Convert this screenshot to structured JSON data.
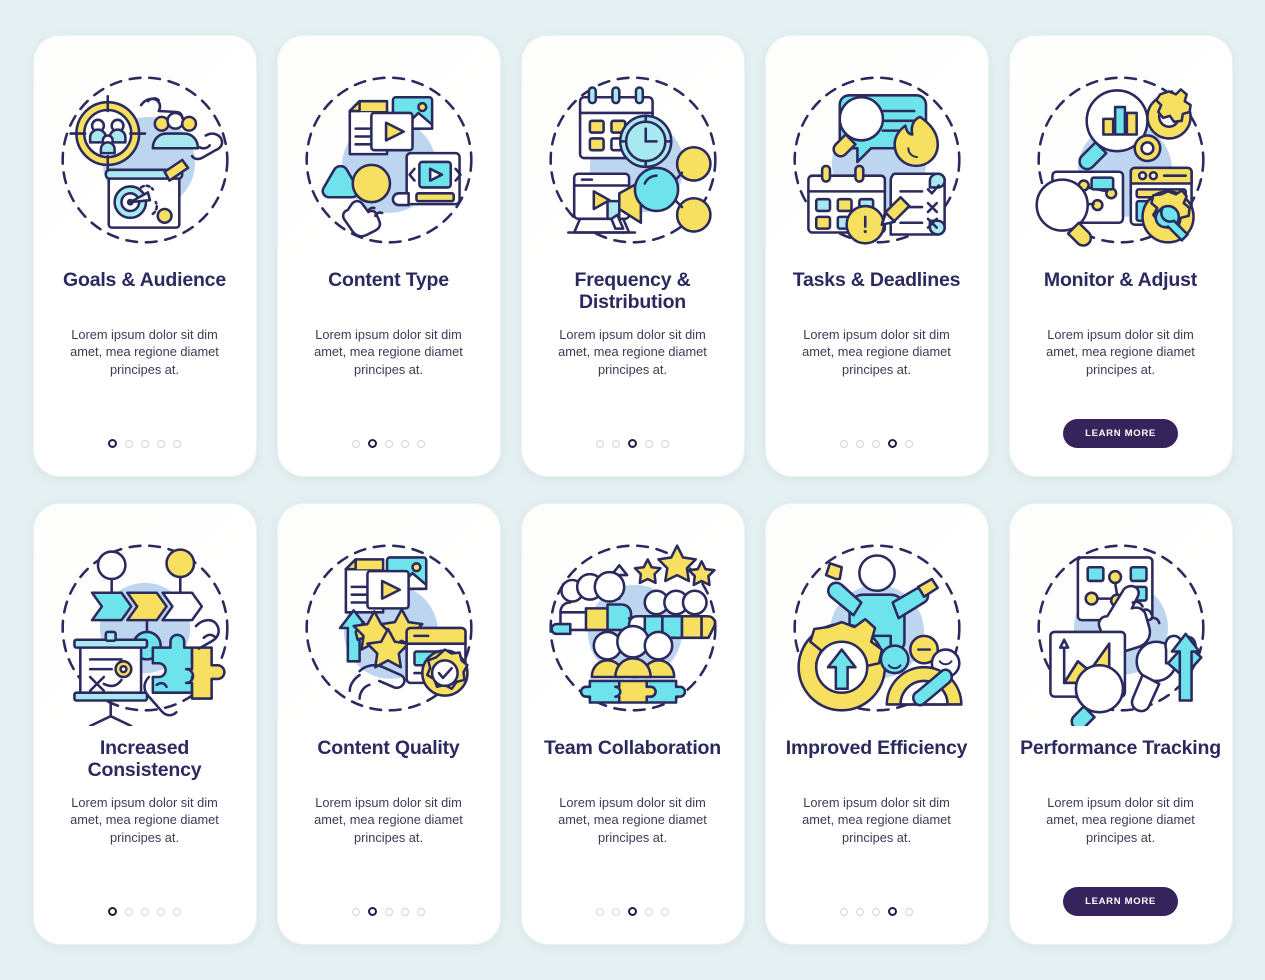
{
  "theme": {
    "page_background": "#e4f0f1",
    "card_background": "#ffffff",
    "title_color": "#2b2a5e",
    "body_text_color": "#3b3b55",
    "button_color": "#35235c",
    "button_text_color": "#ffffff",
    "dot_active_color": "#211b46",
    "dot_inactive_color": "#d3d4dd",
    "accent_yellow": "#f7e05f",
    "accent_cyan": "#6fe3ec",
    "accent_blue_fill": "#bed5f0",
    "accent_light_cyan": "#a8e8f0",
    "stroke_color": "#2b2a5e"
  },
  "shared": {
    "description": "Lorem ipsum dolor sit dim amet, mea regione diamet principes at.",
    "learn_more_label": "Learn more",
    "dot_count": 5
  },
  "screens": [
    {
      "id": "goals-audience",
      "title": "Goals & Audience",
      "description": "Lorem ipsum dolor sit dim amet, mea regione diamet principes at.",
      "footer_type": "dots",
      "active_dot": 1,
      "icon": "target-audience-icon"
    },
    {
      "id": "content-type",
      "title": "Content Type",
      "description": "Lorem ipsum dolor sit dim amet, mea regione diamet principes at.",
      "footer_type": "dots",
      "active_dot": 2,
      "icon": "media-content-icon"
    },
    {
      "id": "frequency-distribution",
      "title": "Frequency & Distribution",
      "description": "Lorem ipsum dolor sit dim amet, mea regione diamet principes at.",
      "footer_type": "dots",
      "active_dot": 3,
      "icon": "calendar-clock-broadcast-icon"
    },
    {
      "id": "tasks-deadlines",
      "title": "Tasks & Deadlines",
      "description": "Lorem ipsum dolor sit dim amet, mea regione diamet principes at.",
      "footer_type": "dots",
      "active_dot": 4,
      "icon": "calendar-checklist-icon"
    },
    {
      "id": "monitor-adjust",
      "title": "Monitor & Adjust",
      "description": "Lorem ipsum dolor sit dim amet, mea regione diamet principes at.",
      "footer_type": "button",
      "button_label": "LEARN MORE",
      "icon": "analytics-gear-icon"
    },
    {
      "id": "increased-consistency",
      "title": "Increased Consistency",
      "description": "Lorem ipsum dolor sit dim amet, mea regione diamet principes at.",
      "footer_type": "dots",
      "active_dot": 1,
      "icon": "whiteboard-puzzle-icon"
    },
    {
      "id": "content-quality",
      "title": "Content Quality",
      "description": "Lorem ipsum dolor sit dim amet, mea regione diamet principes at.",
      "footer_type": "dots",
      "active_dot": 2,
      "icon": "stars-badge-icon"
    },
    {
      "id": "team-collaboration",
      "title": "Team Collaboration",
      "description": "Lorem ipsum dolor sit dim amet, mea regione diamet principes at.",
      "footer_type": "dots",
      "active_dot": 3,
      "icon": "team-people-stars-icon"
    },
    {
      "id": "improved-efficiency",
      "title": "Improved Efficiency",
      "description": "Lorem ipsum dolor sit dim amet, mea regione diamet principes at.",
      "footer_type": "dots",
      "active_dot": 4,
      "icon": "gear-gauge-person-icon"
    },
    {
      "id": "performance-tracking",
      "title": "Performance Tracking",
      "description": "Lorem ipsum dolor sit dim amet, mea regione diamet principes at.",
      "footer_type": "button",
      "button_label": "LEARN MORE",
      "icon": "chart-magnifier-arrow-icon"
    }
  ]
}
